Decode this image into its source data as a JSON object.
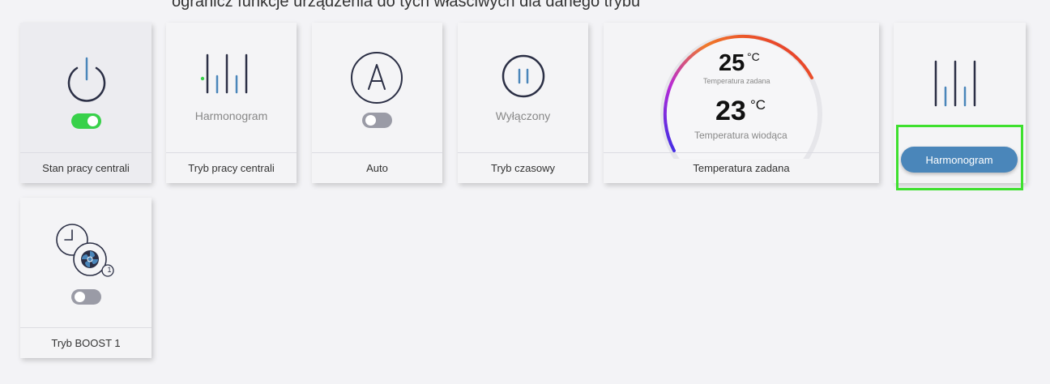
{
  "header": {
    "caption": "ogranicz funkcje urządzenia do tych właściwych dla danego trybu"
  },
  "tiles": [
    {
      "id": "power",
      "icon": "power-icon",
      "label": "Stan pracy centrali",
      "toggle": "on"
    },
    {
      "id": "schedule",
      "icon": "schedule-bars-icon",
      "sub": "Harmonogram",
      "label": "Tryb pracy centrali"
    },
    {
      "id": "auto",
      "icon": "auto-icon",
      "label": "Auto",
      "toggle": "off"
    },
    {
      "id": "timer",
      "icon": "pause-icon",
      "sub": "Wyłączony",
      "label": "Tryb czasowy"
    },
    {
      "id": "boost",
      "icon": "boost-fan-clock-icon",
      "label": "Tryb BOOST 1",
      "toggle": "off",
      "badge": "1"
    }
  ],
  "temperature": {
    "set_value": "25",
    "set_unit": "°C",
    "set_label": "Temperatura zadana",
    "lead_value": "23",
    "lead_unit": "°C",
    "lead_label": "Temperatura wiodąca",
    "footer": "Temperatura zadana"
  },
  "schedule_button": {
    "label": "Harmonogram"
  },
  "colors": {
    "background": "#f3f3f6",
    "toggle_on": "#38d14a",
    "toggle_off": "#9a9ba6",
    "button": "#4a86ba",
    "highlight": "#3ee02e",
    "icon_dark": "#2b2f45",
    "icon_blue": "#4a86ba"
  }
}
